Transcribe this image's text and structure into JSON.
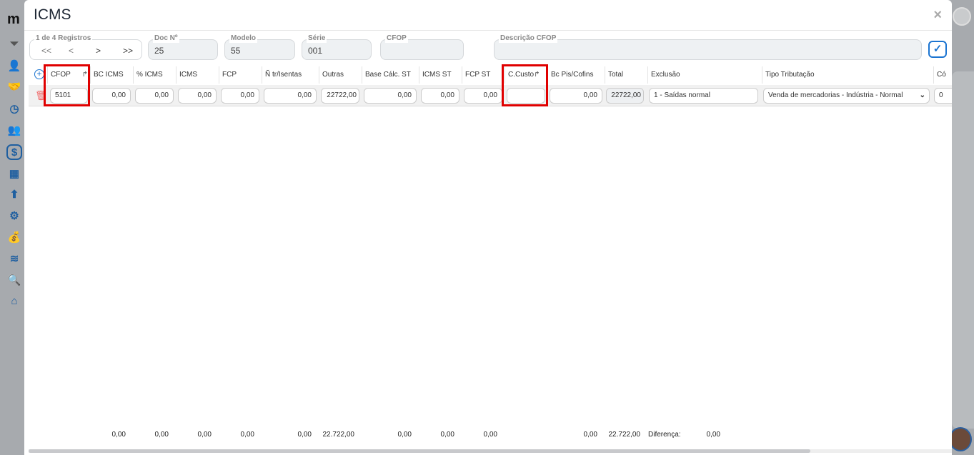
{
  "sidebar": {
    "logo": "m",
    "icons": [
      "filter-icon",
      "user-gear-icon",
      "handshake-icon",
      "clock-icon",
      "users-icon",
      "dollar-icon",
      "calculator-icon",
      "tools-icon",
      "gear-icon",
      "money-bag-icon",
      "layers-icon",
      "search-icon",
      "home-icon"
    ]
  },
  "modal": {
    "title": "ICMS",
    "close": "×"
  },
  "nav": {
    "label": "1 de 4 Registros",
    "first": "<<",
    "prev": "<",
    "next": ">",
    "last": ">>"
  },
  "fields": {
    "doc_label": "Doc Nº",
    "doc": "25",
    "modelo_label": "Modelo",
    "modelo": "55",
    "serie_label": "Série",
    "serie": "001",
    "cfop_label": "CFOP",
    "cfop": "",
    "desc_label": "Descrição CFOP",
    "desc": ""
  },
  "columns": [
    "CFOP",
    "BC ICMS",
    "% ICMS",
    "ICMS",
    "FCP",
    "Ñ tr/Isentas",
    "Outras",
    "Base Cálc. ST",
    "ICMS ST",
    "FCP ST",
    "C.Custo",
    "Bc Pis/Cofins",
    "Total",
    "Exclusão",
    "Tipo Tributação",
    "Có"
  ],
  "row": [
    "5101",
    "0,00",
    "0,00",
    "0,00",
    "0,00",
    "0,00",
    "22722,00",
    "0,00",
    "0,00",
    "0,00",
    "",
    "0,00",
    "22722,00",
    "1 - Saídas normal",
    "Venda de mercadorias - Indústria - Normal",
    "0"
  ],
  "totals": {
    "bc_icms": "0,00",
    "pct_icms": "0,00",
    "icms": "0,00",
    "fcp": "0,00",
    "isentas": "0,00",
    "outras": "22.722,00",
    "base_st": "0,00",
    "icms_st": "0,00",
    "fcp_st": "0,00",
    "bc_pis": "0,00",
    "total": "22.722,00",
    "diff_label": "Diferença:",
    "diff": "0,00"
  }
}
